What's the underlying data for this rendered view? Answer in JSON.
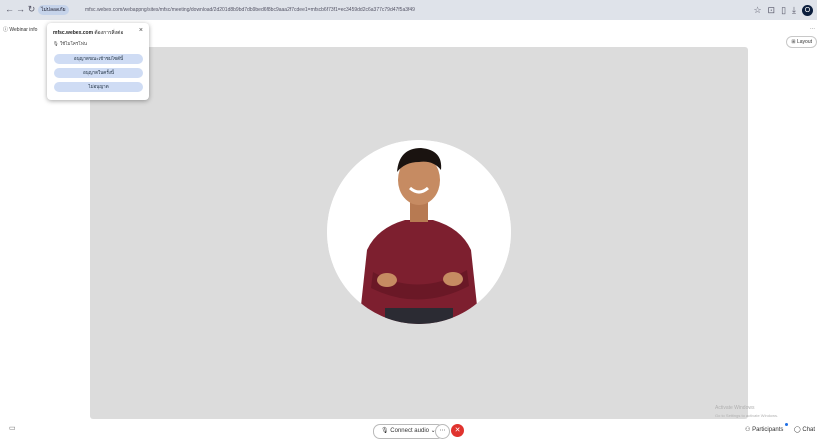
{
  "browser": {
    "site_badge": "ไม่ปลอดภัย",
    "url": "mfsc.webex.com/webappng/sites/mfsc/meeting/download/2d201d8b9bd7db9bed6f8bc9aaa2f7cdee1=mfscb6f73f1=ec3459dd2c6a377c79d47f5a3f49",
    "avatar_letter": "O"
  },
  "webinar_info": "Webinar info",
  "layout_button": "Layout",
  "popup": {
    "site": "mfsc.webex.com",
    "title_suffix": "ต้องการสิ่งต่อ",
    "permission": "ใช้ไมโครโฟน",
    "buttons": [
      "อนุญาตขณะเข้าชมไซต์นี้",
      "อนุญาตในครั้งนี้",
      "ไม่อนุญาต"
    ]
  },
  "controls": {
    "connect_audio": "Connect audio",
    "participants": "Participants",
    "chat": "Chat"
  },
  "watermark": [
    "Activate Windows",
    "Go to Settings to activate Windows."
  ],
  "icons": {
    "back": "arrow-left-icon",
    "forward": "arrow-right-icon",
    "reload": "reload-icon",
    "mic": "microphone-icon",
    "close": "close-icon",
    "end": "hangup-icon"
  }
}
